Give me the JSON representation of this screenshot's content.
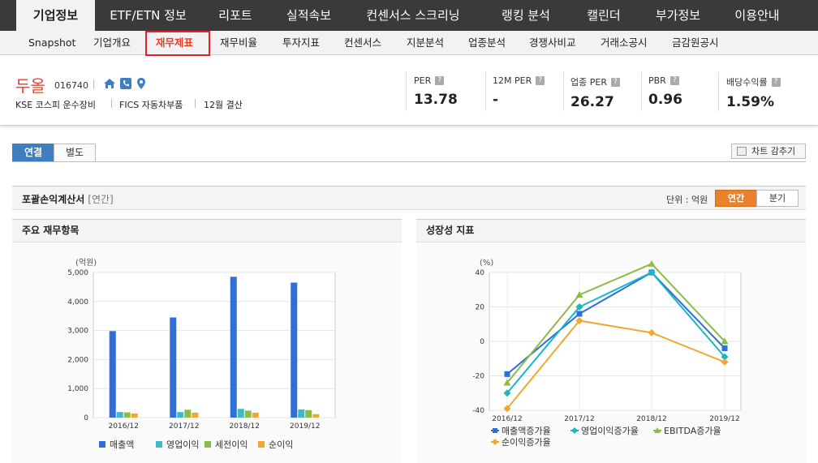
{
  "nav": {
    "items": [
      "기업정보",
      "ETF/ETN 정보",
      "리포트",
      "실적속보",
      "컨센서스 스크리닝",
      "랭킹 분석",
      "캘린더",
      "부가정보",
      "이용안내"
    ],
    "active": 0
  },
  "subnav": {
    "items": [
      "Snapshot",
      "기업개요",
      "재무제표",
      "재무비율",
      "투자지표",
      "컨센서스",
      "지분분석",
      "업종분석",
      "경쟁사비교",
      "거래소공시",
      "금감원공시"
    ],
    "active": 2
  },
  "company": {
    "name": "두올",
    "code": "016740",
    "market": "KSE  코스피  운수장비",
    "fics": "FICS 자동차부품",
    "settle": "12월 결산",
    "stats": [
      {
        "label": "PER",
        "value": "13.78"
      },
      {
        "label": "12M PER",
        "value": "-"
      },
      {
        "label": "업종 PER",
        "value": "26.27"
      },
      {
        "label": "PBR",
        "value": "0.96"
      },
      {
        "label": "배당수익률",
        "value": "1.59%"
      }
    ]
  },
  "tabs": {
    "consolidated": "연결",
    "separate": "별도",
    "hide_chart": "차트 감추기"
  },
  "section": {
    "title": "포괄손익계산서",
    "subtitle": "[연간]",
    "unit": "단위 : 억원",
    "annual": "연간",
    "quarter": "분기"
  },
  "left_panel": {
    "title": "주요 재무항목"
  },
  "right_panel": {
    "title": "성장성 지표"
  },
  "chart_data": [
    {
      "type": "bar",
      "ylabel": "(억원)",
      "categories": [
        "2016/12",
        "2017/12",
        "2018/12",
        "2019/12"
      ],
      "ylim": [
        0,
        5000
      ],
      "yticks": [
        "0",
        "1,000",
        "2,000",
        "3,000",
        "4,000",
        "5,000"
      ],
      "series": [
        {
          "name": "매출액",
          "color": "#2f6fd6",
          "values": [
            2980,
            3450,
            4850,
            4650
          ]
        },
        {
          "name": "영업이익",
          "color": "#3fb8c8",
          "values": [
            190,
            190,
            300,
            280
          ]
        },
        {
          "name": "세전이익",
          "color": "#8dbb46",
          "values": [
            180,
            270,
            240,
            260
          ]
        },
        {
          "name": "순이익",
          "color": "#f0a830",
          "values": [
            140,
            170,
            170,
            120
          ]
        }
      ]
    },
    {
      "type": "line",
      "ylabel": "(%)",
      "categories": [
        "2016/12",
        "2017/12",
        "2018/12",
        "2019/12"
      ],
      "ylim": [
        -40,
        40
      ],
      "yticks": [
        "-40",
        "-20",
        "0",
        "20",
        "40"
      ],
      "series": [
        {
          "name": "매출액증가율",
          "color": "#2f6fd6",
          "marker": "square",
          "values": [
            -19,
            16,
            40,
            -4
          ]
        },
        {
          "name": "영업이익증가율",
          "color": "#18b6c7",
          "marker": "diamond",
          "values": [
            -30,
            20,
            40,
            -9
          ]
        },
        {
          "name": "EBITDA증가율",
          "color": "#8dbb46",
          "marker": "triangle",
          "values": [
            -24,
            27,
            45,
            0
          ]
        },
        {
          "name": "순이익증가율",
          "color": "#f0a830",
          "marker": "diamond",
          "values": [
            -39,
            12,
            5,
            -12
          ]
        }
      ]
    }
  ]
}
